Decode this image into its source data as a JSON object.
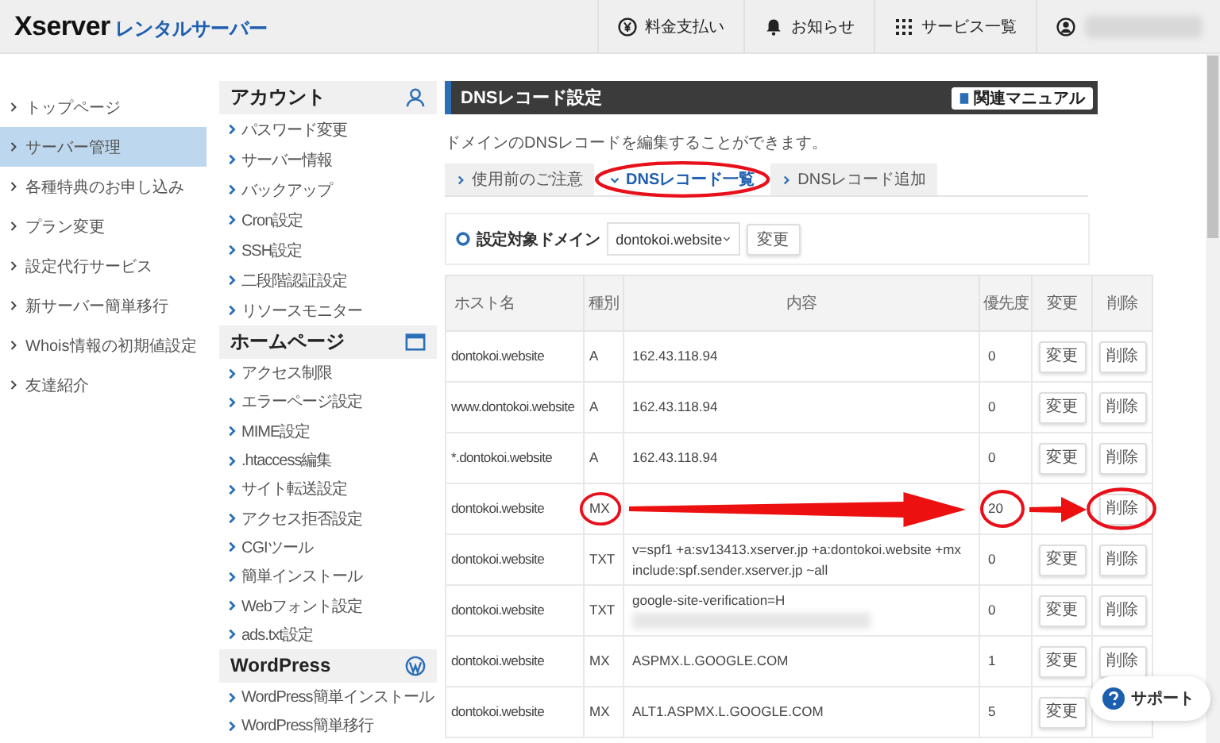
{
  "header": {
    "brand": "Xserver",
    "product": "レンタルサーバー",
    "nav": [
      {
        "kind": "yen",
        "label": "料金支払い"
      },
      {
        "kind": "bell",
        "label": "お知らせ"
      },
      {
        "kind": "grid",
        "label": "サービス一覧"
      }
    ],
    "user": {
      "redacted": true
    }
  },
  "left_nav": [
    {
      "label": "トップページ",
      "selected": false
    },
    {
      "label": "サーバー管理",
      "selected": true
    },
    {
      "label": "各種特典のお申し込み",
      "selected": false
    },
    {
      "label": "プラン変更",
      "selected": false
    },
    {
      "label": "設定代行サービス",
      "selected": false
    },
    {
      "label": "新サーバー簡単移行",
      "selected": false
    },
    {
      "label": "Whois情報の初期値設定",
      "selected": false
    },
    {
      "label": "友達紹介",
      "selected": false
    }
  ],
  "side_menu": [
    {
      "title": "アカウント",
      "kind": "person",
      "items": [
        "パスワード変更",
        "サーバー情報",
        "バックアップ",
        "Cron設定",
        "SSH設定",
        "二段階認証設定",
        "リソースモニター"
      ]
    },
    {
      "title": "ホームページ",
      "kind": "window",
      "items": [
        "アクセス制限",
        "エラーページ設定",
        "MIME設定",
        ".htaccess編集",
        "サイト転送設定",
        "アクセス拒否設定",
        "CGIツール",
        "簡単インストール",
        "Webフォント設定",
        "ads.txt設定"
      ]
    },
    {
      "title": "WordPress",
      "kind": "wordpress",
      "items": [
        "WordPress簡単インストール",
        "WordPress簡単移行"
      ]
    }
  ],
  "main": {
    "title": "DNSレコード設定",
    "manual_button": "関連マニュアル",
    "description": "ドメインのDNSレコードを編集することができます。",
    "tabs": [
      {
        "label": "使用前のご注意",
        "selected": false,
        "circled": false
      },
      {
        "label": "DNSレコード一覧",
        "selected": true,
        "circled": true
      },
      {
        "label": "DNSレコード追加",
        "selected": false,
        "circled": false
      }
    ],
    "domain": {
      "label": "設定対象ドメイン",
      "value": "dontokoi.website",
      "button": "変更"
    },
    "columns": [
      "ホスト名",
      "種別",
      "内容",
      "優先度",
      "変更",
      "削除"
    ],
    "rows": [
      {
        "host": "dontokoi.website",
        "type": "A",
        "content": "162.43.118.94",
        "priority": "0",
        "change": "変更",
        "delete": "削除",
        "annotated": false
      },
      {
        "host": "www.dontokoi.website",
        "type": "A",
        "content": "162.43.118.94",
        "priority": "0",
        "change": "変更",
        "delete": "削除",
        "annotated": false
      },
      {
        "host": "*.dontokoi.website",
        "type": "A",
        "content": "162.43.118.94",
        "priority": "0",
        "change": "変更",
        "delete": "削除",
        "annotated": false
      },
      {
        "host": "dontokoi.website",
        "type": "MX",
        "priority": "20",
        "delete": "削除",
        "annotated": true
      },
      {
        "host": "dontokoi.website",
        "type": "TXT",
        "content": "v=spf1 +a:sv13413.xserver.jp +a:dontokoi.website +mx include:spf.sender.xserver.jp ~all",
        "priority": "0",
        "change": "変更",
        "delete": "削除",
        "annotated": false
      },
      {
        "host": "dontokoi.website",
        "type": "TXT",
        "content": "google-site-verification=H",
        "redacted": true,
        "priority": "0",
        "change": "変更",
        "delete": "削除",
        "annotated": false
      },
      {
        "host": "dontokoi.website",
        "type": "MX",
        "content": "ASPMX.L.GOOGLE.COM",
        "priority": "1",
        "change": "変更",
        "delete": "削除",
        "annotated": false
      },
      {
        "host": "dontokoi.website",
        "type": "MX",
        "content": "ALT1.ASPMX.L.GOOGLE.COM",
        "priority": "5",
        "change": "変更",
        "annotated": false
      }
    ]
  },
  "support_button": "サポート"
}
